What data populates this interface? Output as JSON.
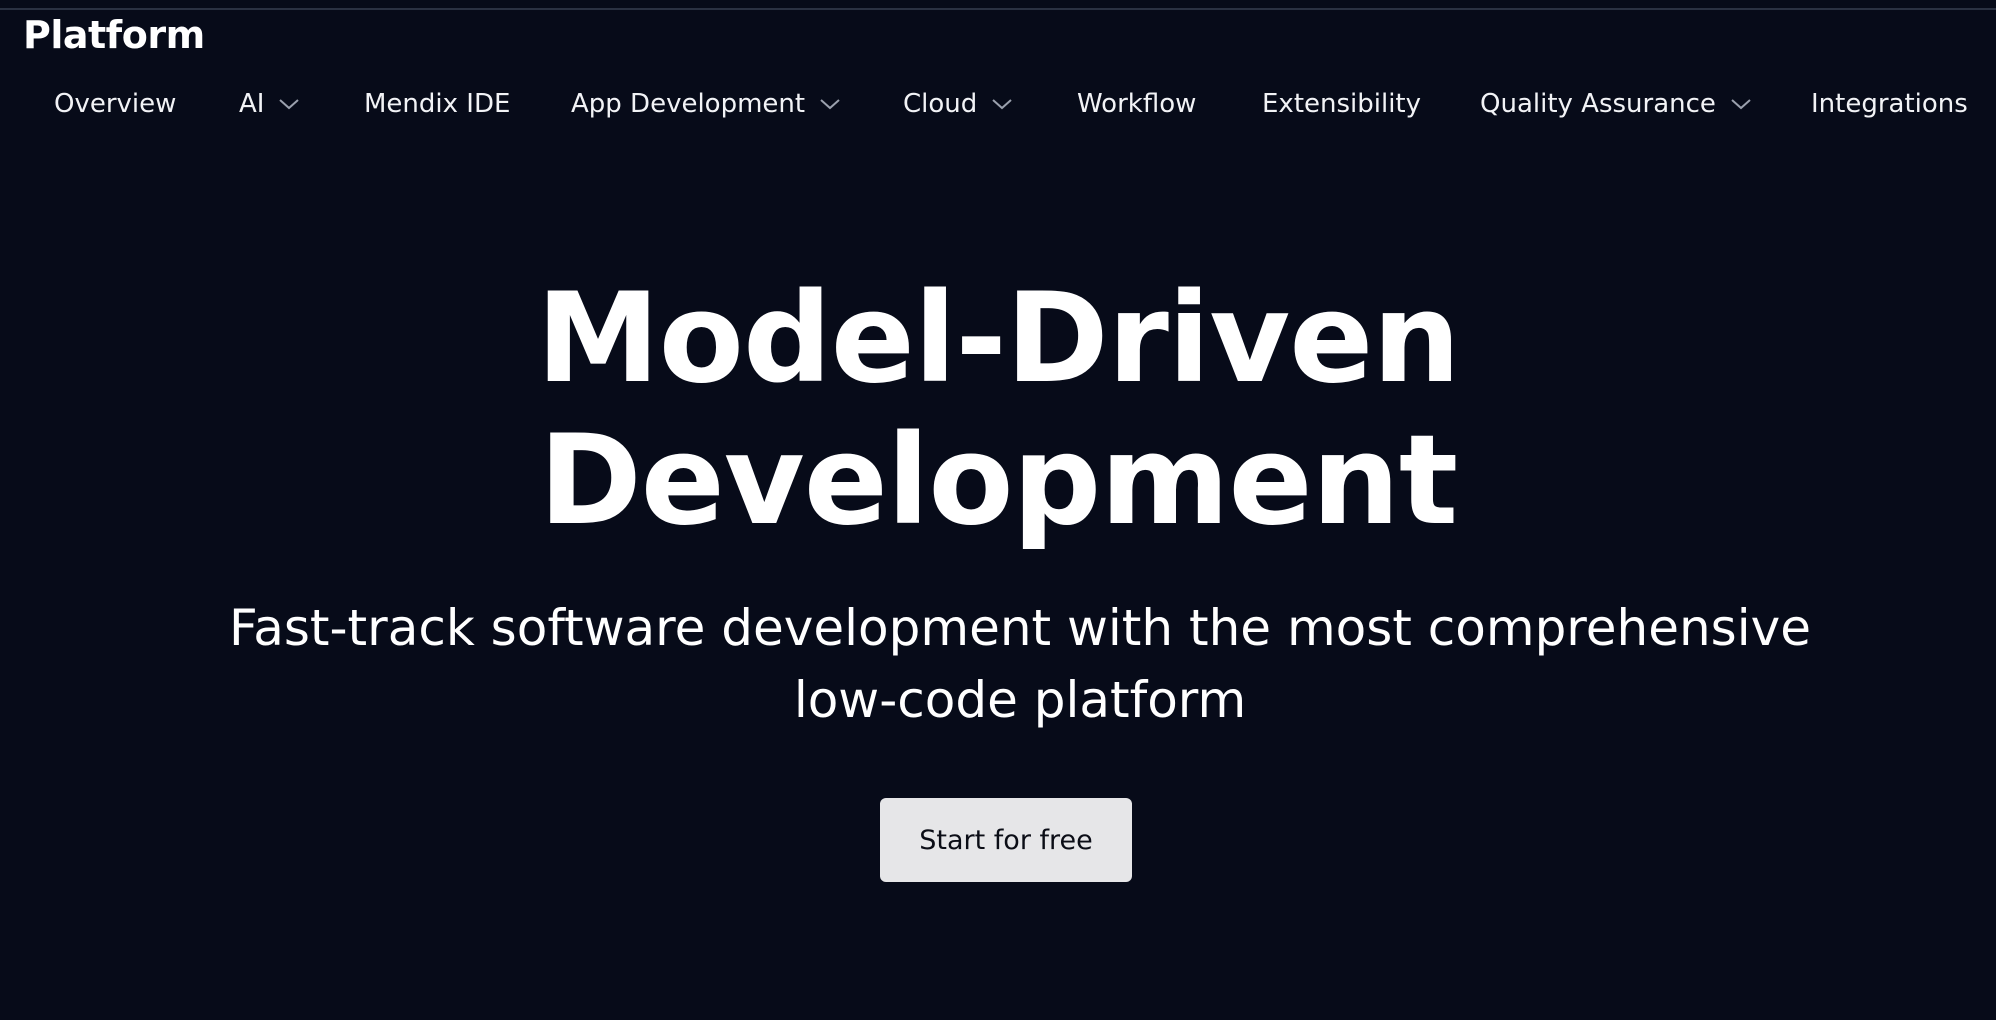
{
  "header": {
    "title": "Platform"
  },
  "nav": {
    "items": [
      {
        "label": "Overview",
        "has_dropdown": false
      },
      {
        "label": "AI",
        "has_dropdown": true,
        "icon": "chevron-down-icon"
      },
      {
        "label": "Mendix IDE",
        "has_dropdown": false
      },
      {
        "label": "App Development",
        "has_dropdown": true,
        "icon": "chevron-down-icon"
      },
      {
        "label": "Cloud",
        "has_dropdown": true,
        "icon": "chevron-down-icon"
      },
      {
        "label": "Workflow",
        "has_dropdown": false
      },
      {
        "label": "Extensibility",
        "has_dropdown": false
      },
      {
        "label": "Quality Assurance",
        "has_dropdown": true,
        "icon": "chevron-down-icon"
      },
      {
        "label": "Integrations",
        "has_dropdown": false
      }
    ]
  },
  "hero": {
    "title_line1": "Model-Driven",
    "title_line2": "Development",
    "subtitle_line1": "Fast-track software development with the most comprehensive",
    "subtitle_line2": "low-code platform",
    "cta_label": "Start for free"
  },
  "colors": {
    "background": "#070b19",
    "text": "#ffffff",
    "cta_background": "#e6e6e8",
    "cta_text": "#0b0d16"
  }
}
